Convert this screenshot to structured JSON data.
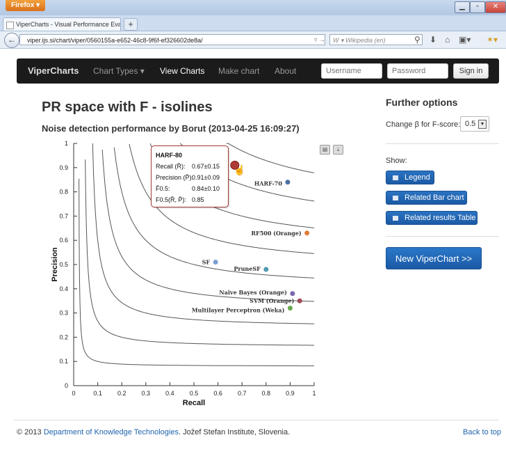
{
  "browser": {
    "app_button": "Firefox ▾",
    "tab_title": "ViperCharts - Visual Performance Evalua...",
    "url": "viper.ijs.si/chart/viper/0560155a-e652-46c8-9f6f-ef326602de8a/",
    "search_placeholder": "W ▾ Wikipedia (en)"
  },
  "nav": {
    "brand": "ViperCharts",
    "chart_types": "Chart Types ▾",
    "view_charts": "View Charts",
    "make_chart": "Make chart",
    "about": "About",
    "username_placeholder": "Username",
    "password_placeholder": "Password",
    "sign_in": "Sign in"
  },
  "page": {
    "title": "PR space with F - isolines",
    "subtitle": "Noise detection performance by Borut (2013-04-25 16:09:27)"
  },
  "sidebar": {
    "title": "Further options",
    "beta_label": "Change β for F-score:",
    "beta_value": "0.5",
    "show_label": "Show:",
    "legend_btn": "Legend",
    "bar_chart_btn": "Related Bar chart",
    "results_table_btn": "Related results Table",
    "new_chart_btn": "New ViperChart >>"
  },
  "tooltip": {
    "title": "HARF-80",
    "recall_label": "Recall (R̄):",
    "recall_value": "0.67±0.15",
    "precision_label": "Precision (P̄):",
    "precision_value": "0.91±0.09",
    "f_label": "F̄0.5:",
    "f_value": "0.84±0.10",
    "f2_label": "F0.5(R̄, P̄):",
    "f2_value": "0.85"
  },
  "footer": {
    "copyright": "© 2013",
    "dept_link": "Department of Knowledge Technologies",
    "institute": ". Jožef Stefan Institute, Slovenia.",
    "back_to_top": "Back to top"
  },
  "chart_data": {
    "type": "scatter",
    "xlabel": "Recall",
    "ylabel": "Precision",
    "xlim": [
      0,
      1
    ],
    "ylim": [
      0,
      1
    ],
    "x_ticks": [
      "0",
      "0.1",
      "0.2",
      "0.3",
      "0.4",
      "0.5",
      "0.6",
      "0.7",
      "0.8",
      "0.9",
      "1"
    ],
    "y_ticks": [
      "0",
      "0.1",
      "0.2",
      "0.3",
      "0.4",
      "0.5",
      "0.6",
      "0.7",
      "0.8",
      "0.9",
      "1"
    ],
    "beta": 0.5,
    "isolines_f": [
      0.1,
      0.2,
      0.3,
      0.4,
      0.5,
      0.6,
      0.7,
      0.8,
      0.9
    ],
    "points": [
      {
        "name": "HARF-80",
        "x": 0.67,
        "y": 0.91,
        "color": "#b03a37",
        "highlight": true
      },
      {
        "name": "HARF-70",
        "x": 0.89,
        "y": 0.84,
        "color": "#4a6fa5"
      },
      {
        "name": "RF500 (Orange)",
        "x": 0.97,
        "y": 0.63,
        "color": "#e07b39"
      },
      {
        "name": "SF",
        "x": 0.59,
        "y": 0.51,
        "color": "#7a9fd0"
      },
      {
        "name": "PruneSF",
        "x": 0.8,
        "y": 0.48,
        "color": "#4f9ab0"
      },
      {
        "name": "Naive Bayes (Orange)",
        "x": 0.91,
        "y": 0.38,
        "color": "#7b68b0"
      },
      {
        "name": "SVM (Orange)",
        "x": 0.94,
        "y": 0.35,
        "color": "#9e4a55"
      },
      {
        "name": "Multilayer Perceptron (Weka)",
        "x": 0.9,
        "y": 0.32,
        "color": "#6aa84f"
      }
    ]
  },
  "colors": {
    "navbar_bg": "#1b1b1b",
    "button_blue": "#1f63ad",
    "link": "#1f63ad"
  }
}
